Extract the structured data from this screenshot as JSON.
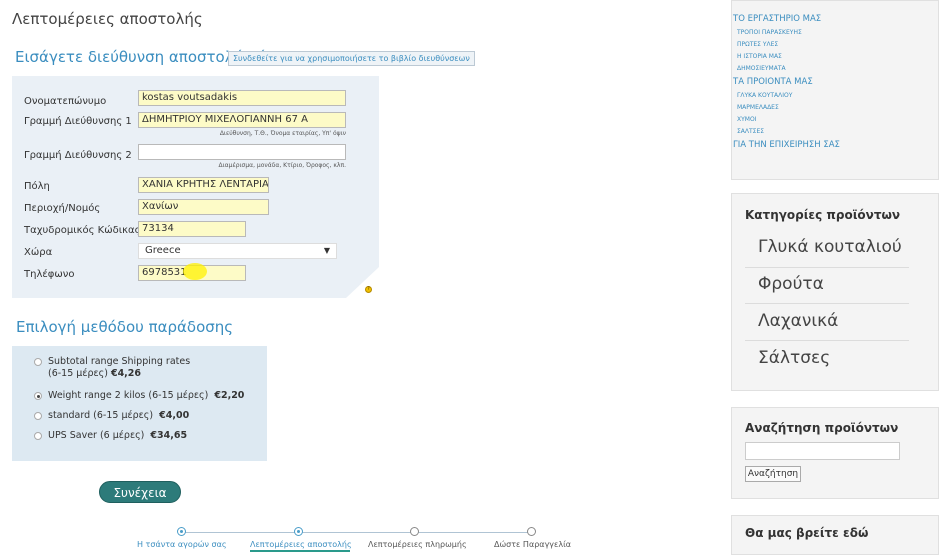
{
  "page_title": "Λεπτομέρειες αποστολής",
  "address_section": {
    "title": "Εισάγετε διεύθυνση αποστολής ή",
    "address_book_button": "Συνδεθείτε για να χρησιμοποιήσετε το βιβλίο διευθύνσεων",
    "fields": {
      "fullname": {
        "label": "Ονοματεπώνυμο",
        "value": "kostas voutsadakis"
      },
      "address1": {
        "label": "Γραμμή Διεύθυνσης 1",
        "value": "ΔΗΜΗΤΡΙΟΥ ΜΙΧΕΛΟΓΙΑΝΝΗ 67 Α",
        "hint": "Διεύθυνση, Τ.Θ., Όνομα εταιρίας, Υπ' όψιν"
      },
      "address2": {
        "label": "Γραμμή Διεύθυνσης 2",
        "value": "",
        "hint": "Διαμέρισμα, μονάδα, Κτίριο, Όροφος, κλπ."
      },
      "city": {
        "label": "Πόλη",
        "value": "ΧΑΝΙΑ ΚΡΗΤΗΣ ΛΕΝΤΑΡΙΑ"
      },
      "region": {
        "label": "Περιοχή/Νομός",
        "value": "Χανίων"
      },
      "postcode": {
        "label": "Ταχυδρομικός Κώδικας",
        "value": "73134"
      },
      "country": {
        "label": "Χώρα",
        "value": "Greece"
      },
      "phone": {
        "label": "Τηλέφωνο",
        "value": "6978531"
      }
    }
  },
  "shipping_section": {
    "title": "Επιλογή μεθόδου παράδοσης",
    "options": [
      {
        "label": "Subtotal range Shipping rates",
        "label2": "(6-15 μέρες)",
        "price": "€4,26",
        "selected": false
      },
      {
        "label": "Weight range 2 kilos (6-15 μέρες)",
        "price": "€2,20",
        "selected": true
      },
      {
        "label": "standard (6-15 μέρες)",
        "price": "€4,00",
        "selected": false
      },
      {
        "label": "UPS Saver (6 μέρες)",
        "price": "€34,65",
        "selected": false
      }
    ],
    "continue_button": "Συνέχεια"
  },
  "steps": [
    {
      "label": "Η τσάντα αγορών σας",
      "state": "done"
    },
    {
      "label": "Λεπτομέρειες αποστολής",
      "state": "active"
    },
    {
      "label": "Λεπτομέρειες πληρωμής",
      "state": "todo"
    },
    {
      "label": "Δώστε Παραγγελία",
      "state": "todo"
    }
  ],
  "sidebar": {
    "menu": [
      {
        "label": "ΤΟ ΕΡΓΑΣΤΗΡΙΟ ΜΑΣ",
        "level": 0
      },
      {
        "label": "ΤΡΟΠΟΙ ΠΑΡΑΣΚΕΥΗΣ",
        "level": 1
      },
      {
        "label": "ΠΡΩΤΕΣ ΥΛΕΣ",
        "level": 1
      },
      {
        "label": "Η ΙΣΤΟΡΙΑ ΜΑΣ",
        "level": 1
      },
      {
        "label": "ΔΗΜΟΣΙΕΥΜΑΤΑ",
        "level": 1
      },
      {
        "label": "ΤΑ ΠΡΟΙΟΝΤΑ ΜΑΣ",
        "level": 0
      },
      {
        "label": "ΓΛΥΚΑ ΚΟΥΤΑΛΙΟΥ",
        "level": 1
      },
      {
        "label": "ΜΑΡΜΕΛΑΔΕΣ",
        "level": 1
      },
      {
        "label": "ΧΥΜΟΙ",
        "level": 1
      },
      {
        "label": "ΣΑΛΤΣΕΣ",
        "level": 1
      },
      {
        "label": "ΓΙΑ ΤΗΝ ΕΠΙΧΕΙΡΗΣΗ ΣΑΣ",
        "level": 0
      }
    ],
    "categories_title": "Κατηγορίες προϊόντων",
    "categories": [
      "Γλυκά κουταλιού",
      "Φρούτα",
      "Λαχανικά",
      "Σάλτσες"
    ],
    "search_title": "Αναζήτηση προϊόντων",
    "search_value": "",
    "search_button": "Αναζήτηση",
    "find_us_title": "Θα μας βρείτε εδώ"
  }
}
